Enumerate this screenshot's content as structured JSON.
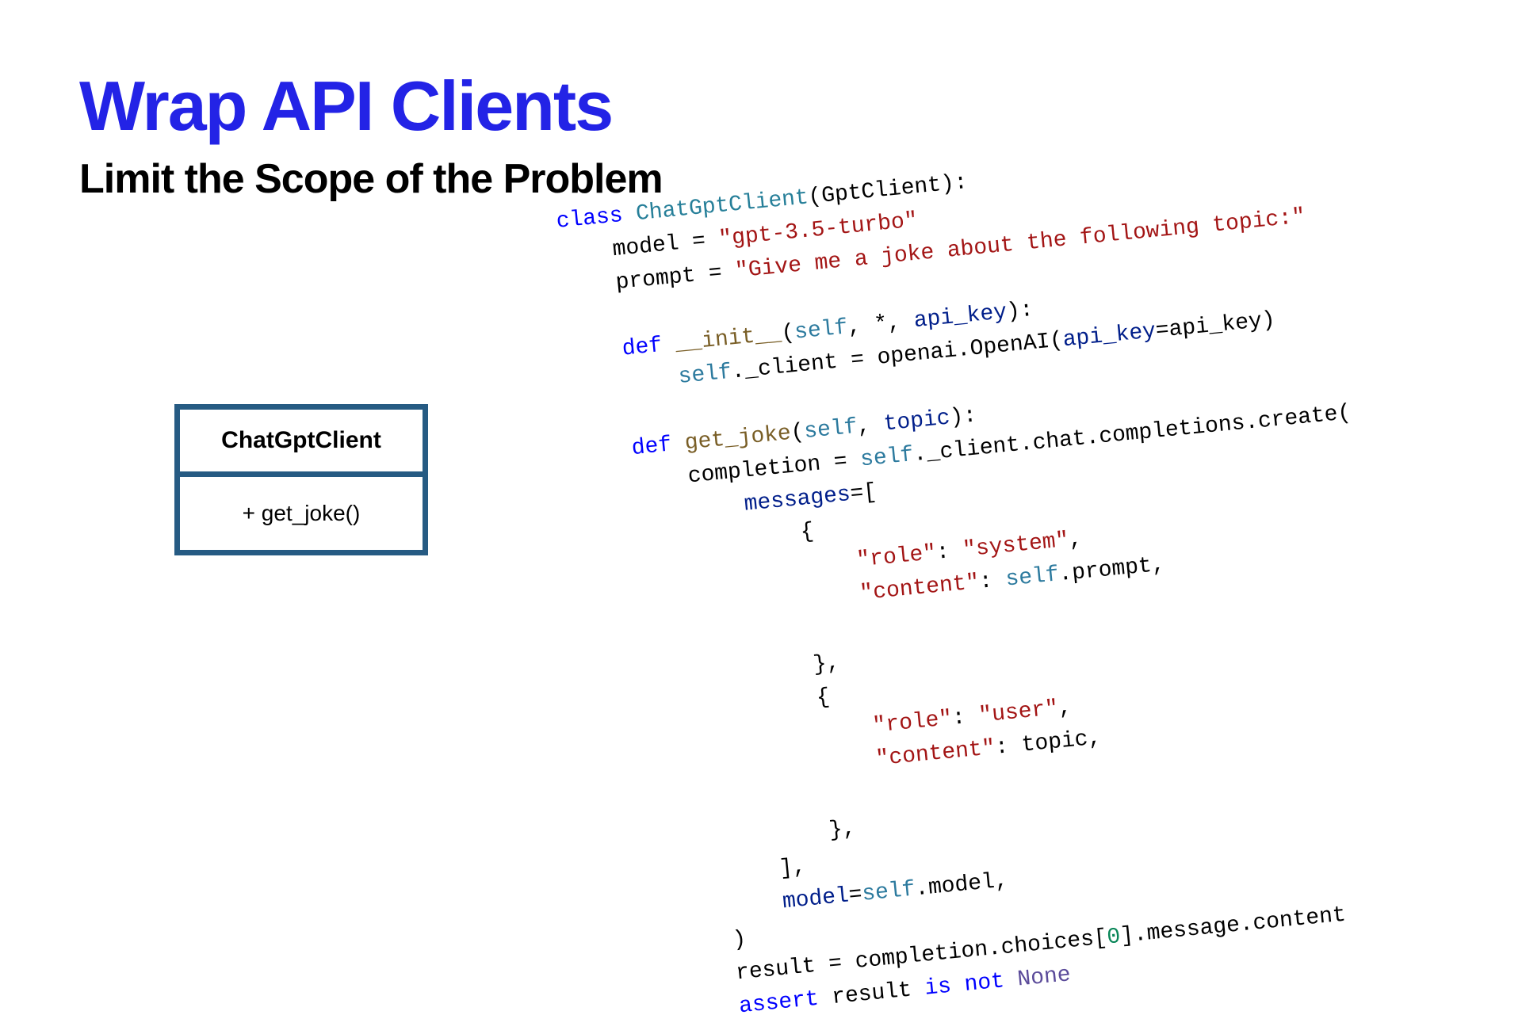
{
  "title": "Wrap API Clients",
  "subtitle": "Limit the Scope of the Problem",
  "uml": {
    "class_name": "ChatGptClient",
    "method": "+ get_joke()"
  },
  "code": {
    "line1_kw": "class",
    "line1_cls": " ChatGptClient",
    "line1_rest": "(GptClient):",
    "line2_pre": "    model = ",
    "line2_str": "\"gpt-3.5-turbo\"",
    "line3_pre": "    prompt = ",
    "line3_str": "\"Give me a joke about the following topic:\"",
    "blank1": "",
    "line4_pre": "    ",
    "line4_def": "def",
    "line4_sp": " ",
    "line4_fn": "__init__",
    "line4_open": "(",
    "line4_self": "self",
    "line4_mid": ", *, ",
    "line4_param": "api_key",
    "line4_close": "):",
    "line5_pre": "        ",
    "line5_self": "self",
    "line5_mid": "._client = openai.OpenAI(",
    "line5_param": "api_key",
    "line5_eq": "=api_key)",
    "blank2": "",
    "line6_pre": "    ",
    "line6_def": "def",
    "line6_sp": " ",
    "line6_fn": "get_joke",
    "line6_open": "(",
    "line6_self": "self",
    "line6_mid": ", ",
    "line6_param": "topic",
    "line6_close": "):",
    "line7_pre": "        completion = ",
    "line7_self": "self",
    "line7_rest": "._client.chat.completions.create(",
    "line8_pre": "            ",
    "line8_param": "messages",
    "line8_rest": "=[",
    "line9": "                {",
    "line10_pre": "                    ",
    "line10_k": "\"role\"",
    "line10_colon": ": ",
    "line10_v": "\"system\"",
    "line10_comma": ",",
    "line11_pre": "                    ",
    "line11_k": "\"content\"",
    "line11_colon": ": ",
    "line11_self": "self",
    "line11_rest": ".prompt,",
    "blank3": "",
    "line12": "                },",
    "line13": "                {",
    "line14_pre": "                    ",
    "line14_k": "\"role\"",
    "line14_colon": ": ",
    "line14_v": "\"user\"",
    "line14_comma": ",",
    "line15_pre": "                    ",
    "line15_k": "\"content\"",
    "line15_colon": ": topic,",
    "blank4": "",
    "line16": "                },",
    "line17": "            ],",
    "line18_pre": "            ",
    "line18_param": "model",
    "line18_eq": "=",
    "line18_self": "self",
    "line18_rest": ".model,",
    "line19": "        )",
    "line20_pre": "        result = completion.choices[",
    "line20_num": "0",
    "line20_rest": "].message.content",
    "line21_pre": "        ",
    "line21_kw": "assert",
    "line21_mid": " result ",
    "line21_is": "is not",
    "line21_sp": " ",
    "line21_none": "None"
  }
}
